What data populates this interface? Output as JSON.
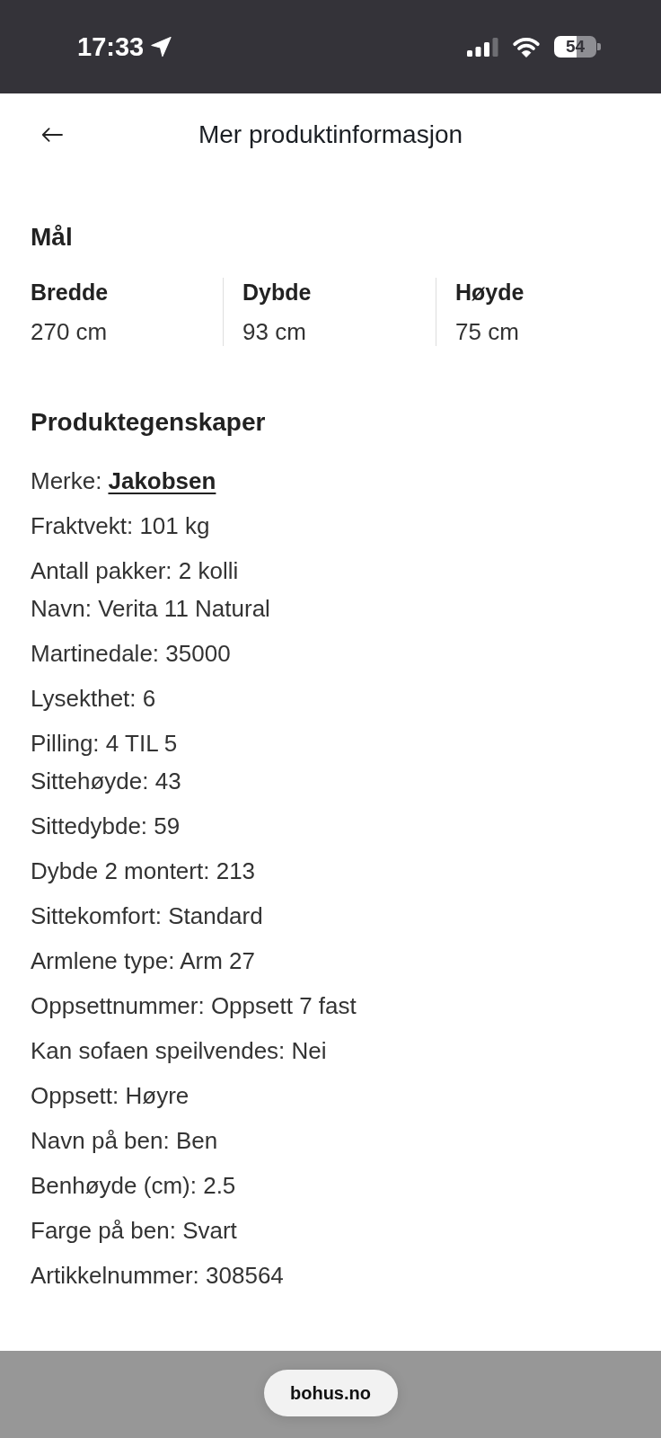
{
  "status_bar": {
    "time": "17:33",
    "battery": "54"
  },
  "header": {
    "title": "Mer produktinformasjon"
  },
  "dimensions": {
    "title": "Mål",
    "items": [
      {
        "label": "Bredde",
        "value": "270 cm"
      },
      {
        "label": "Dybde",
        "value": "93 cm"
      },
      {
        "label": "Høyde",
        "value": "75 cm"
      }
    ]
  },
  "properties": {
    "title": "Produktegenskaper",
    "groups": [
      {
        "lines": [
          {
            "kind": "link",
            "label": "Merke:",
            "value": "Jakobsen"
          }
        ]
      },
      {
        "lines": [
          {
            "kind": "text",
            "label": "Fraktvekt:",
            "value": "101 kg"
          }
        ]
      },
      {
        "lines": [
          {
            "kind": "text",
            "label": "Antall pakker:",
            "value": "2 kolli"
          },
          {
            "kind": "text",
            "label": "Navn:",
            "value": "Verita 11 Natural"
          }
        ]
      },
      {
        "lines": [
          {
            "kind": "text",
            "label": "Martinedale:",
            "value": "35000"
          }
        ]
      },
      {
        "lines": [
          {
            "kind": "text",
            "label": "Lysekthet:",
            "value": "6"
          }
        ]
      },
      {
        "lines": [
          {
            "kind": "text",
            "label": "Pilling:",
            "value": "4 TIL 5"
          },
          {
            "kind": "text",
            "label": "Sittehøyde:",
            "value": "43"
          }
        ]
      },
      {
        "lines": [
          {
            "kind": "text",
            "label": "Sittedybde:",
            "value": "59"
          }
        ]
      },
      {
        "lines": [
          {
            "kind": "text",
            "label": "Dybde 2 montert:",
            "value": "213"
          }
        ]
      },
      {
        "lines": [
          {
            "kind": "text",
            "label": "Sittekomfort:",
            "value": "Standard"
          }
        ]
      },
      {
        "lines": [
          {
            "kind": "text",
            "label": "Armlene type:",
            "value": "Arm 27"
          }
        ]
      },
      {
        "lines": [
          {
            "kind": "text",
            "label": "Oppsettnummer:",
            "value": "Oppsett 7 fast"
          }
        ]
      },
      {
        "lines": [
          {
            "kind": "text",
            "label": "Kan sofaen speilvendes:",
            "value": "Nei"
          }
        ]
      },
      {
        "lines": [
          {
            "kind": "text",
            "label": "Oppsett:",
            "value": "Høyre"
          }
        ]
      },
      {
        "lines": [
          {
            "kind": "text",
            "label": "Navn på ben:",
            "value": "Ben"
          }
        ]
      },
      {
        "lines": [
          {
            "kind": "text",
            "label": "Benhøyde (cm):",
            "value": "2.5"
          }
        ]
      },
      {
        "lines": [
          {
            "kind": "text",
            "label": "Farge på ben:",
            "value": "Svart"
          }
        ]
      },
      {
        "lines": [
          {
            "kind": "text",
            "label": "Artikkelnummer:",
            "value": "308564"
          }
        ]
      }
    ]
  },
  "browser_bar": {
    "url": "bohus.no"
  }
}
